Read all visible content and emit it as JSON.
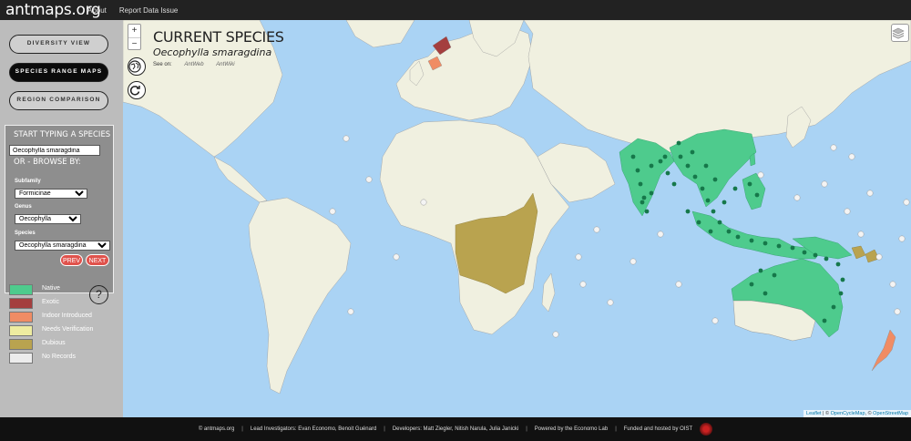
{
  "topbar": {
    "brand": "antmaps.org",
    "links": [
      "About",
      "Report Data Issue"
    ]
  },
  "sidebar": {
    "modes": [
      "DIVERSITY VIEW",
      "SPECIES RANGE MAPS",
      "REGION COMPARISON"
    ],
    "active_mode": "SPECIES RANGE MAPS",
    "search": {
      "heading": "START TYPING A SPECIES",
      "input_value": "Oecophylla smaragdina",
      "browse_label": "OR - BROWSE BY:",
      "subfamily_label": "Subfamily",
      "subfamily_value": "Formicinae",
      "genus_label": "Genus",
      "genus_value": "Oecophylla",
      "species_label": "Species",
      "species_value": "Oecophylla smaragdina",
      "prev_label": "PREV",
      "next_label": "NEXT"
    },
    "legend": [
      {
        "label": "Native",
        "color": "#4ecb8d"
      },
      {
        "label": "Exotic",
        "color": "#a43e3e"
      },
      {
        "label": "Indoor Introduced",
        "color": "#f08c64"
      },
      {
        "label": "Needs Verification",
        "color": "#eeeca0"
      },
      {
        "label": "Dubious",
        "color": "#b9a34f"
      },
      {
        "label": "No Records",
        "color": "#ececec"
      }
    ],
    "help_label": "?"
  },
  "map": {
    "zoom_in": "+",
    "zoom_out": "−",
    "globe_icon": "globe-icon",
    "refresh_icon": "refresh-icon",
    "title": "CURRENT SPECIES",
    "species": "Oecophylla smaragdina",
    "see_on_label": "See on:",
    "see_on_links": [
      "AntWeb",
      "AntWiki"
    ],
    "layers_icon": "layers-icon",
    "attribution_leaflet": "Leaflet",
    "attribution_sep": " | © ",
    "attribution_ocm": "OpenCycleMap",
    "attribution_mid": ", © ",
    "attribution_osm": "OpenStreetMap",
    "colors": {
      "ocean": "#aad3f4",
      "no_records": "#f0f0e0",
      "native": "#4ecb8d",
      "native_point": "#16784a",
      "dubious": "#b9a34f",
      "indoor": "#f08c64",
      "exotic": "#a43e3e"
    }
  },
  "footer": {
    "copyright": "© antmaps.org",
    "investigators": "Lead Investigators: Evan Economo, Benoit Guénard",
    "developers": "Developers: Matt Ziegler, Nitish Narula, Julia Janicki",
    "powered": "Powered by the Economo Lab",
    "funded": "Funded and hosted by OIST",
    "separator": "|"
  }
}
